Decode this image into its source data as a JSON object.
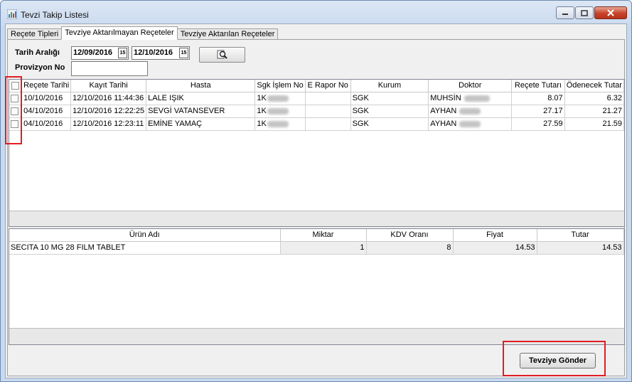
{
  "window": {
    "title": "Tevzi Takip Listesi",
    "icon": "chart-app-icon"
  },
  "tabs": [
    {
      "label": "Reçete Tipleri"
    },
    {
      "label": "Tevziye Aktarılmayan Reçeteler"
    },
    {
      "label": "Tevziye Aktarılan Reçeteler"
    }
  ],
  "filters": {
    "date_range_label": "Tarih Aralığı",
    "date_from": "12/09/2016",
    "date_to": "12/10/2016",
    "provision_label": "Provizyon No",
    "provision_value": ""
  },
  "prescriptions": {
    "headers": [
      "Reçete Tarihi",
      "Kayıt Tarihi",
      "Hasta",
      "Sgk İşlem No",
      "E Rapor No",
      "Kurum",
      "Doktor",
      "Reçete Tutarı",
      "Ödenecek Tutar"
    ],
    "rows": [
      {
        "recete_tarihi": "10/10/2016",
        "kayit_tarihi": "12/10/2016 11:44:36",
        "hasta": "LALE IŞIK",
        "sgk_islem_no": "1K",
        "e_rapor_no": "",
        "kurum": "SGK",
        "doktor": "MUHSİN",
        "recete_tutari": "8.07",
        "odenecek_tutar": "6.32"
      },
      {
        "recete_tarihi": "04/10/2016",
        "kayit_tarihi": "12/10/2016 12:22:25",
        "hasta": "SEVGİ VATANSEVER",
        "sgk_islem_no": "1K",
        "e_rapor_no": "",
        "kurum": "SGK",
        "doktor": "AYHAN",
        "recete_tutari": "27.17",
        "odenecek_tutar": "21.27"
      },
      {
        "recete_tarihi": "04/10/2016",
        "kayit_tarihi": "12/10/2016 12:23:11",
        "hasta": "EMİNE YAMAÇ",
        "sgk_islem_no": "1K",
        "e_rapor_no": "",
        "kurum": "SGK",
        "doktor": "AYHAN",
        "recete_tutari": "27.59",
        "odenecek_tutar": "21.59"
      }
    ]
  },
  "products": {
    "headers": [
      "Ürün Adı",
      "Miktar",
      "KDV Oranı",
      "Fiyat",
      "Tutar"
    ],
    "rows": [
      {
        "urun_adi": "SECITA 10 MG 28 FILM TABLET",
        "miktar": "1",
        "kdv_orani": "8",
        "fiyat": "14.53",
        "tutar": "14.53"
      }
    ]
  },
  "actions": {
    "send_label": "Tevziye Gönder"
  },
  "colors": {
    "highlight": "#e01d24",
    "title_bar": "#c9d9ee"
  }
}
